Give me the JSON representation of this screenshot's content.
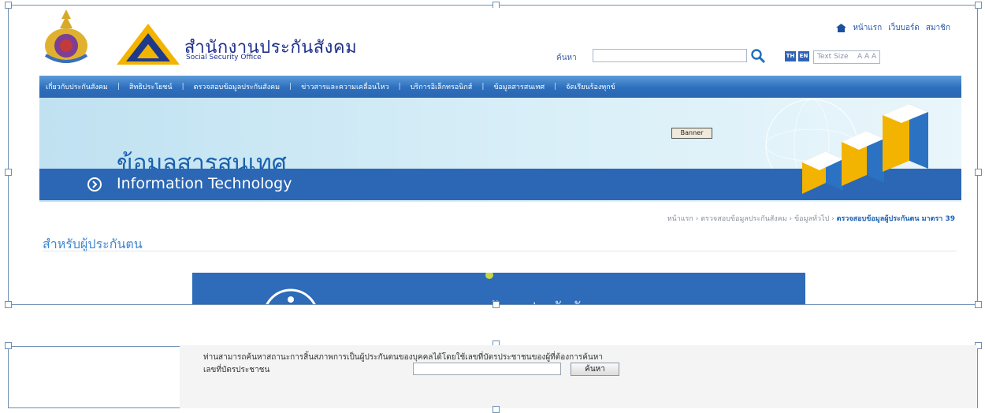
{
  "header": {
    "org_name_th": "สำนักงานประกันสังคม",
    "org_name_en": "Social Security Office",
    "top_links": [
      "หน้าแรก",
      "เว็บบอร์ด",
      "สมาชิก"
    ],
    "search_label": "ค้นหา",
    "search_value": "",
    "lang_th": "TH",
    "lang_en": "EN",
    "text_size_label": "Text Size",
    "text_size_options": "A A A"
  },
  "nav": {
    "items": [
      "เกี่ยวกับประกันสังคม",
      "สิทธิประโยชน์",
      "ตรวจสอบข้อมูลประกันสังคม",
      "ข่าวสารและความเคลื่อนไหว",
      "บริการอิเล็กทรอนิกส์",
      "ข้อมูลสารสนเทศ",
      "จัดเรียนร้องทุกข์"
    ],
    "separator": "|"
  },
  "banner": {
    "title_th": "ข้อมูลสารสนเทศ",
    "title_en": "Information Technology",
    "tag": "Banner"
  },
  "breadcrumb": {
    "items": [
      "หน้าแรก",
      "ตรวจสอบข้อมูลประกันสังคม",
      "ข้อมูลทั่วไป"
    ],
    "current": "ตรวจสอบข้อมูลผู้ประกันตน มาตรา 39",
    "separator": "›"
  },
  "section": {
    "title": "สำหรับผู้ประกันตน",
    "image_banner_title": "ตรวจสอบข้อมูลประกันสังคม"
  },
  "form": {
    "instruction": "ท่านสามารถค้นหาสถานะการสิ้นสภาพการเป็นผู้ประกันตนของบุคคลได้โดยใช้เลขที่บัตรประชาชนของผู้ที่ต้องการค้นหา",
    "id_label": "เลขที่บัตรประชาชน",
    "id_value": "",
    "search_button": "ค้นหา"
  },
  "colors": {
    "nav": "#2d6fbd",
    "banner_strip": "#2b67b4",
    "accent_text": "#1e63b5"
  }
}
